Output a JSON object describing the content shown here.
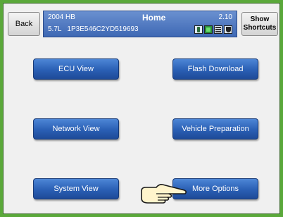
{
  "header": {
    "back_label": "Back",
    "year_model": "2004 HB",
    "engine_vin": "5.7L   1P3E546C2YD519693",
    "title": "Home",
    "version": "2.10",
    "status_icons": [
      "phone-icon",
      "module-icon",
      "network-icon",
      "shield-icon"
    ],
    "shortcuts_line1": "Show",
    "shortcuts_line2": "Shortcuts"
  },
  "menu": {
    "ecu_view": "ECU View",
    "flash_download": "Flash Download",
    "network_view": "Network View",
    "vehicle_preparation": "Vehicle Preparation",
    "system_view": "System View",
    "more_options": "More Options"
  },
  "colors": {
    "border_green": "#5aa83a",
    "header_blue": "#3e68b4",
    "button_blue": "#2a5fb4"
  }
}
